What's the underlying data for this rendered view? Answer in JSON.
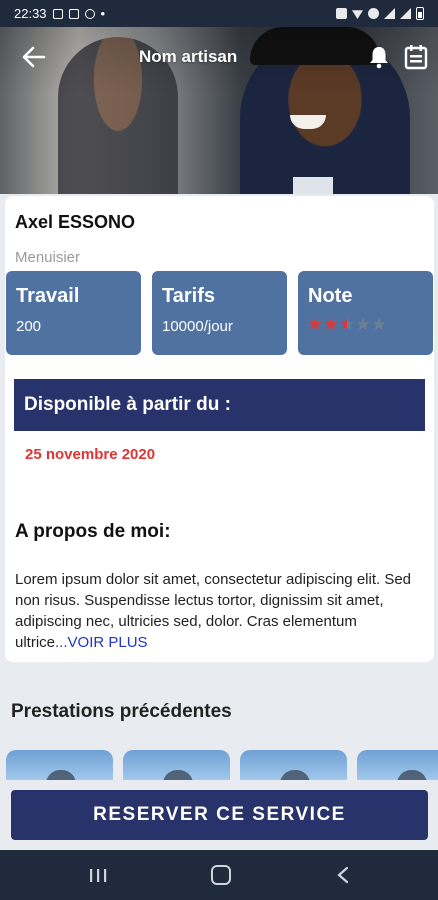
{
  "status_bar": {
    "time": "22:33"
  },
  "header": {
    "title": "Nom artisan"
  },
  "profile": {
    "name": "Axel ESSONO",
    "profession": "Menuisier"
  },
  "stats": [
    {
      "title": "Travail",
      "value": "200"
    },
    {
      "title": "Tarifs",
      "value": "10000/jour"
    },
    {
      "title": "Note",
      "rating": 2.5,
      "max": 5
    }
  ],
  "availability": {
    "label": "Disponible à partir du :",
    "date": "25 novembre 2020"
  },
  "about": {
    "title": "A propos de moi:",
    "text": "Lorem ipsum dolor sit amet, consectetur adipiscing elit. Sed non risus. Suspendisse lectus tortor, dignissim sit amet, adipiscing nec, ultricies sed, dolor. Cras elementum ultrice",
    "more_link": "...VOIR PLUS"
  },
  "previous_services": {
    "title": "Prestations précédentes"
  },
  "cta": {
    "label": "RESERVER CE SERVICE"
  },
  "colors": {
    "primary": "#27336a",
    "stat_card": "#4f72a0",
    "date": "#e23434",
    "link": "#1f35c9",
    "star_on": "#d63a3a",
    "star_off": "#6d7f97"
  },
  "icons": [
    "back-arrow-icon",
    "bell-icon",
    "calendar-icon",
    "star-icon",
    "recent-apps-icon",
    "home-icon",
    "nav-back-icon"
  ]
}
